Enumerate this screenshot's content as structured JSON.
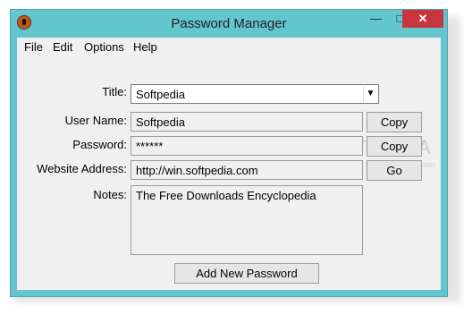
{
  "window": {
    "title": "Password Manager",
    "controls": {
      "minimize": "—",
      "maximize": "□",
      "close": "✕"
    }
  },
  "menu": [
    "File",
    "Edit",
    "Options",
    "Help"
  ],
  "form": {
    "title_label": "Title:",
    "title_value": "Softpedia",
    "username_label": "User Name:",
    "username_value": "Softpedia",
    "password_label": "Password:",
    "password_value": "******",
    "website_label": "Website Address:",
    "website_value": "http://win.softpedia.com",
    "notes_label": "Notes:",
    "notes_value": "The Free Downloads Encyclopedia"
  },
  "buttons": {
    "copy_username": "Copy",
    "copy_password": "Copy",
    "go": "Go",
    "add_new": "Add New Password"
  },
  "watermark": {
    "text": "SOFTPEDIA",
    "sub": "www.softpedia.com"
  }
}
